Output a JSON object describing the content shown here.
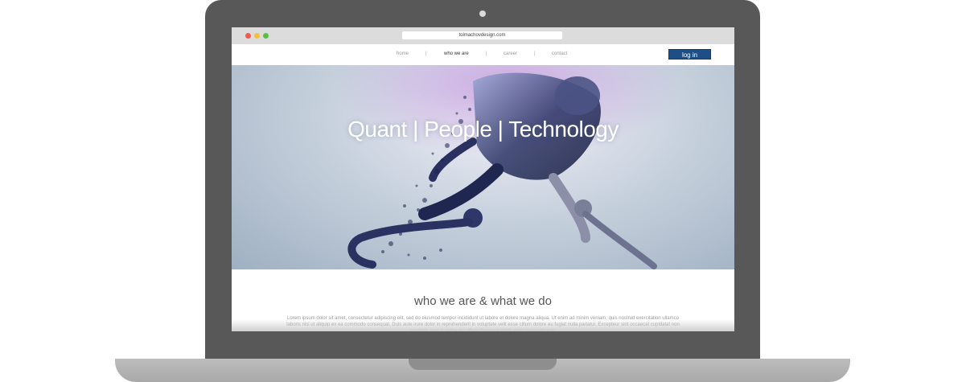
{
  "browser": {
    "url": "tolmachovdesign.com"
  },
  "nav": {
    "items": [
      {
        "label": "home"
      },
      {
        "label": "who we are"
      },
      {
        "label": "career"
      },
      {
        "label": "contact"
      }
    ],
    "separator": "|",
    "login_label": "log in"
  },
  "hero": {
    "title": "Quant | People | Technology"
  },
  "section": {
    "title": "who we are & what we do",
    "body": "Lorem ipsum dolor sit amet, consectetur adipiscing elit, sed do eiusmod tempor incididunt ut labore et dolore magna aliqua. Ut enim ad minim veniam, quis nostrud exercitation ullamco laboris nisi ut aliquip ex ea commodo consequat. Duis aute irure dolor in reprehenderit in voluptate velit esse cillum dolore eu fugiat nulla pariatur. Excepteur sint occaecat cupidatat non proident, sunt in culpa qui officia deserunt mollit anim id est laborum."
  },
  "colors": {
    "login_button": "#1d4f86",
    "laptop_body": "#585858",
    "traffic_red": "#ee5a52",
    "traffic_yellow": "#f4bf3c",
    "traffic_green": "#56c240"
  }
}
